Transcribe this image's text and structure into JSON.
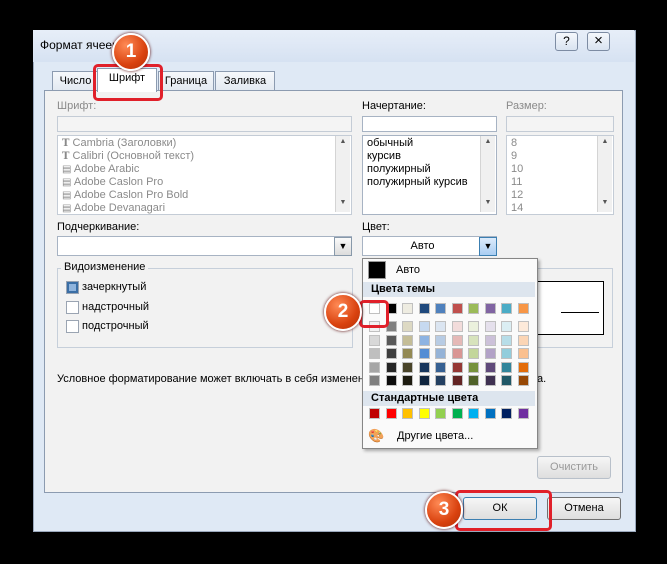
{
  "window": {
    "title": "Формат ячеек",
    "help_icon": "?",
    "close_icon": "×"
  },
  "tabs": [
    {
      "label": "Число"
    },
    {
      "label": "Шрифт"
    },
    {
      "label": "Граница"
    },
    {
      "label": "Заливка"
    }
  ],
  "font": {
    "label": "Шрифт:",
    "items": [
      {
        "label": "Cambria (Заголовки)",
        "icon": "truetype-font-icon"
      },
      {
        "label": "Calibri (Основной текст)",
        "icon": "truetype-font-icon"
      },
      {
        "label": "Adobe Arabic",
        "icon": "opentype-font-icon"
      },
      {
        "label": "Adobe Caslon Pro",
        "icon": "opentype-font-icon"
      },
      {
        "label": "Adobe Caslon Pro Bold",
        "icon": "opentype-font-icon"
      },
      {
        "label": "Adobe Devanagari",
        "icon": "opentype-font-icon"
      }
    ]
  },
  "style": {
    "label": "Начертание:",
    "items": [
      "обычный",
      "курсив",
      "полужирный",
      "полужирный курсив"
    ]
  },
  "size": {
    "label": "Размер:",
    "items": [
      "8",
      "9",
      "10",
      "11",
      "12",
      "14"
    ]
  },
  "underline": {
    "label": "Подчеркивание:",
    "value": ""
  },
  "color": {
    "label": "Цвет:",
    "value": "Авто"
  },
  "effects": {
    "label": "Видоизменение",
    "strikethrough": {
      "label": "зачеркнутый",
      "checked": true
    },
    "superscript": {
      "label": "надстрочный",
      "checked": false
    },
    "subscript": {
      "label": "подстрочный",
      "checked": false
    }
  },
  "info_text": "Условное форматирование может включать в себя изменени",
  "info_text_tail": "а.",
  "color_popup": {
    "auto_label": "Авто",
    "theme_header": "Цвета темы",
    "theme_top": [
      "#ffffff",
      "#000000",
      "#eeece1",
      "#1f497d",
      "#4f81bd",
      "#c0504d",
      "#9bbb59",
      "#8064a2",
      "#4bacc6",
      "#f79646"
    ],
    "theme_shades": [
      [
        "#f2f2f2",
        "#7f7f7f",
        "#ddd9c3",
        "#c6d9f0",
        "#dbe5f1",
        "#f2dcdb",
        "#ebf1dd",
        "#e5e0ec",
        "#dbeef3",
        "#fdeada"
      ],
      [
        "#d8d8d8",
        "#595959",
        "#c4bd97",
        "#8db3e2",
        "#b8cce4",
        "#e5b9b7",
        "#d7e3bc",
        "#ccc1d9",
        "#b7dde8",
        "#fbd5b5"
      ],
      [
        "#bfbfbf",
        "#3f3f3f",
        "#938953",
        "#548dd4",
        "#95b3d7",
        "#d99694",
        "#c3d69b",
        "#b2a2c7",
        "#92cddc",
        "#fac08f"
      ],
      [
        "#a5a5a5",
        "#262626",
        "#494429",
        "#17365d",
        "#366092",
        "#953734",
        "#76923c",
        "#5f497a",
        "#31859b",
        "#e36c09"
      ],
      [
        "#7f7f7f",
        "#0c0c0c",
        "#1d1b10",
        "#0f243e",
        "#244061",
        "#632423",
        "#4f6128",
        "#3f3151",
        "#205867",
        "#974806"
      ]
    ],
    "standard_header": "Стандартные цвета",
    "standard": [
      "#c00000",
      "#ff0000",
      "#ffc000",
      "#ffff00",
      "#92d050",
      "#00b050",
      "#00b0f0",
      "#0070c0",
      "#002060",
      "#7030a0"
    ],
    "more_label": "Другие цвета..."
  },
  "buttons": {
    "clear": "Очистить",
    "ok": "ОК",
    "cancel": "Отмена"
  },
  "markers": [
    "1",
    "2",
    "3"
  ]
}
